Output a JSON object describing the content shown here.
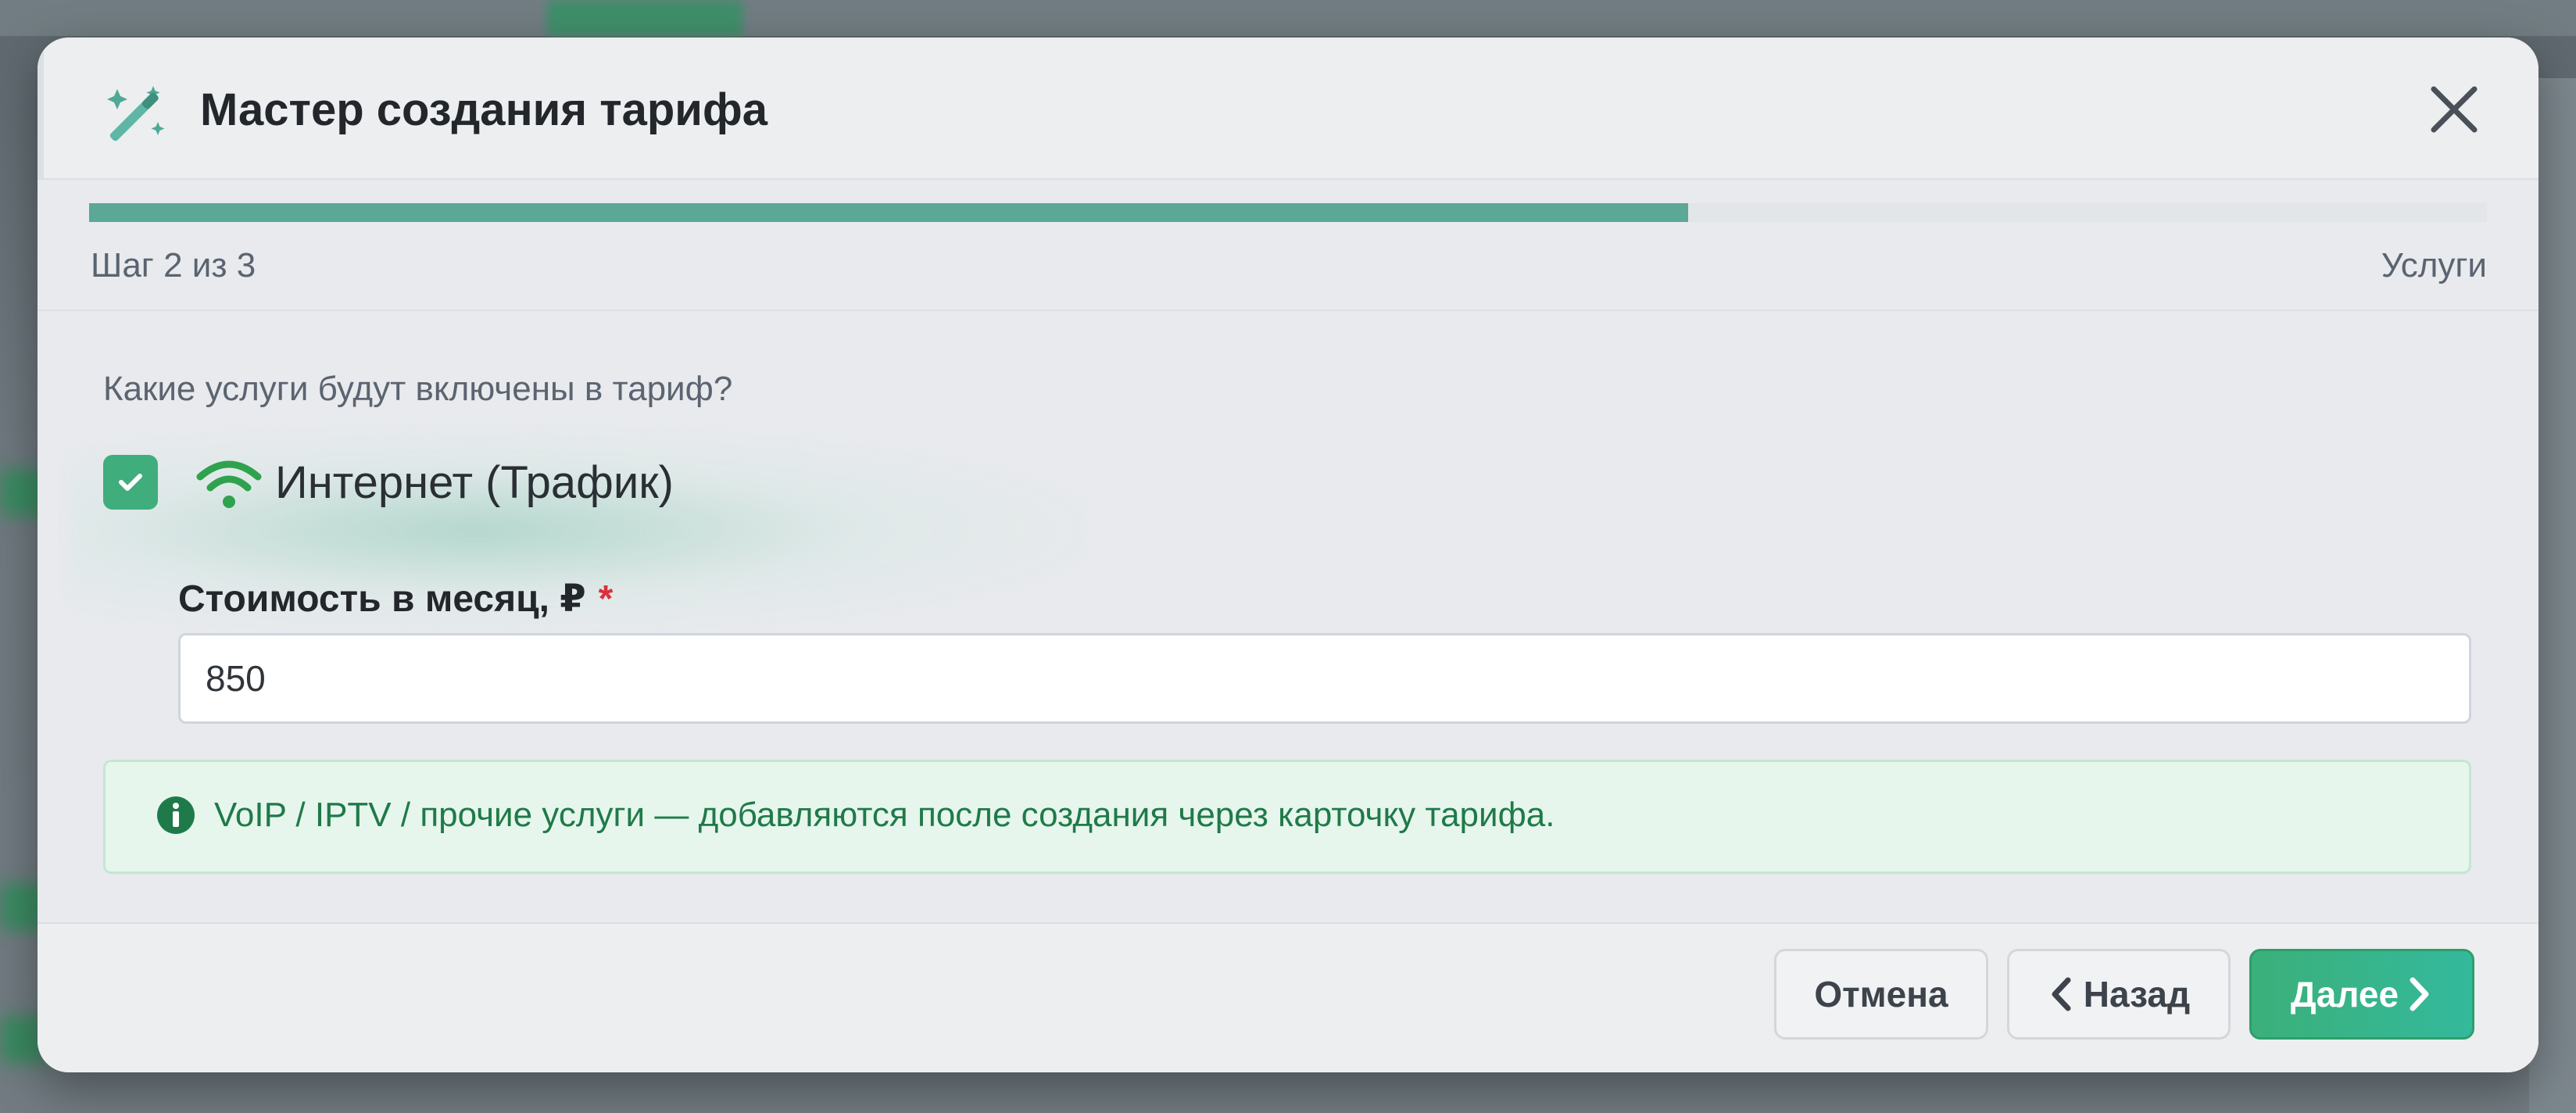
{
  "modal": {
    "title": "Мастер создания тарифа",
    "icon": "magic-wand-icon",
    "close_icon": "close-icon"
  },
  "progress": {
    "step_label": "Шаг 2 из 3",
    "step_name": "Услуги",
    "current_step": 2,
    "total_steps": 3,
    "fill_fraction": 0.667
  },
  "services": {
    "question": "Какие услуги будут включены в тариф?",
    "internet": {
      "checked": true,
      "icon": "wifi-icon",
      "label": "Интернет (Трафик)"
    }
  },
  "cost_field": {
    "label": "Стоимость в месяц, ₽",
    "required_mark": "*",
    "value": "850"
  },
  "info": {
    "icon": "info-circle-icon",
    "text": "VoIP / IPTV / прочие услуги — добавляются после создания через карточку тарифа."
  },
  "footer": {
    "cancel_label": "Отмена",
    "back_label": "Назад",
    "next_label": "Далее"
  },
  "colors": {
    "accent": "#3fae7c",
    "progress": "#5aa895",
    "info_text": "#1f7a49",
    "required": "#d9303e"
  }
}
